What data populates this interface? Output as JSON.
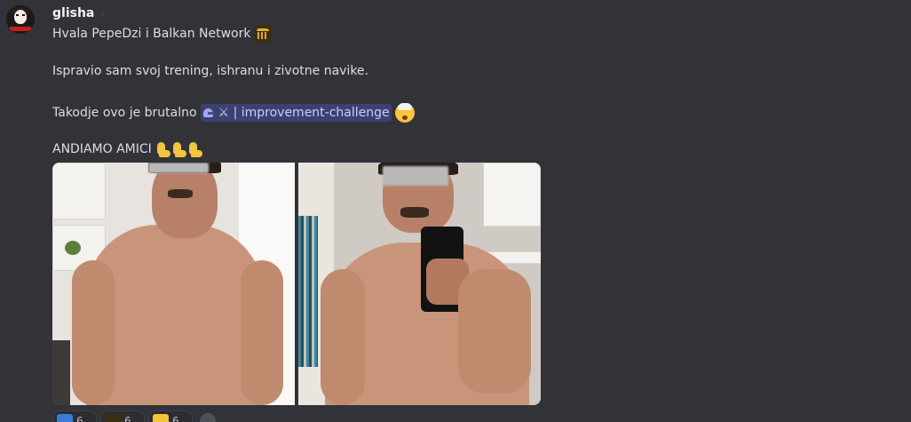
{
  "author": {
    "username": "glisha",
    "avatar_icon": "money-heist-mask-icon"
  },
  "message": {
    "line1_text": "Hvala PepeDzi i Balkan Network",
    "line1_emoji": "bank-icon",
    "line2_text": "Ispravio sam svoj trening, ishranu i zivotne navike.",
    "line3_text": "Takodje ovo je brutalno",
    "channel_mention": "⚔ | improvement-challenge",
    "channel_icon": "helmet-icon",
    "line3_emoji": "exploding-head-icon",
    "line4_text": "ANDIAMO AMICI",
    "line4_emojis": [
      "flexed-biceps-icon",
      "flexed-biceps-icon",
      "flexed-biceps-icon"
    ]
  },
  "attachments": [
    {
      "name": "before-photo"
    },
    {
      "name": "after-photo"
    }
  ],
  "reactions": [
    {
      "icon": "w-emoji-icon",
      "count": "6"
    },
    {
      "icon": "bank-icon",
      "count": "6"
    },
    {
      "icon": "flexed-biceps-icon",
      "count": "6"
    }
  ],
  "colors": {
    "background": "#313338",
    "mention_bg": "#3c4270",
    "mention_text": "#c9cdfb"
  }
}
